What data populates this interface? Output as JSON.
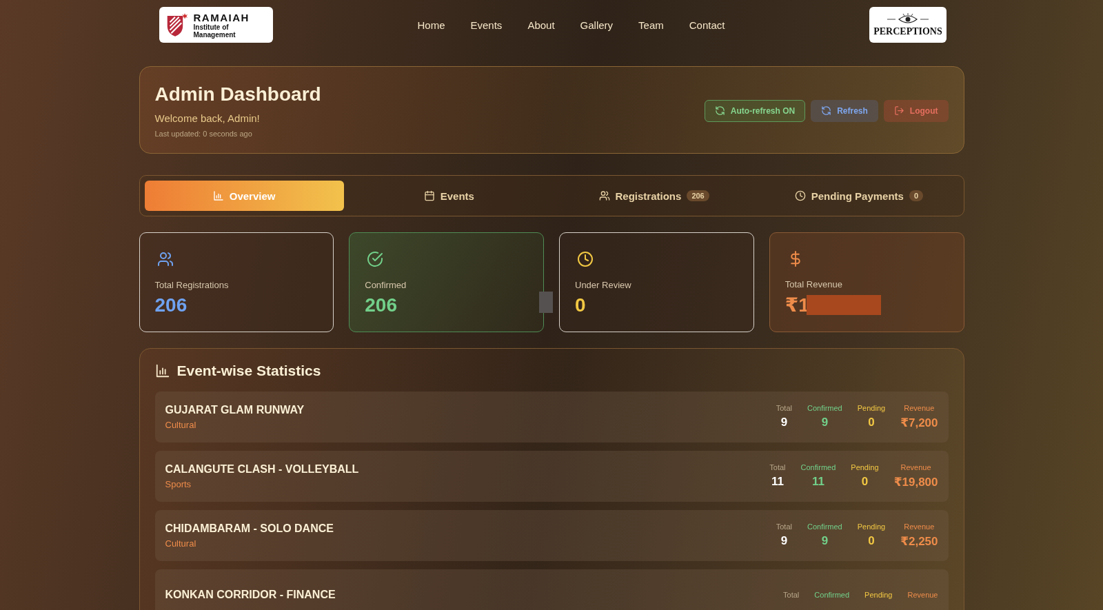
{
  "header": {
    "logo": {
      "title": "RAMAIAH",
      "subtitle": "Institute of Management"
    },
    "nav": [
      "Home",
      "Events",
      "About",
      "Gallery",
      "Team",
      "Contact"
    ],
    "brand_logo": {
      "text": "PERCEPTIONS"
    }
  },
  "dashboard": {
    "title": "Admin Dashboard",
    "welcome": "Welcome back, Admin!",
    "last_updated": "Last updated: 0 seconds ago",
    "buttons": [
      {
        "label": "Auto-refresh ON",
        "kind": "auto"
      },
      {
        "label": "Refresh",
        "kind": "refresh"
      },
      {
        "label": "Logout",
        "kind": "logout"
      }
    ]
  },
  "tabs": [
    {
      "label": "Overview",
      "kind": "chart",
      "selected": true
    },
    {
      "label": "Events",
      "kind": "calendar",
      "selected": false
    },
    {
      "label": "Registrations",
      "kind": "users",
      "badge": "206",
      "selected": false
    },
    {
      "label": "Pending Payments",
      "kind": "clock",
      "badge": "0",
      "selected": false
    }
  ],
  "stat_cards": [
    {
      "kind": "users",
      "label": "Total Registrations",
      "value": "206",
      "color": "#6fa2f0"
    },
    {
      "kind": "confirmed",
      "label": "Confirmed",
      "value": "206",
      "color": "#72d08a"
    },
    {
      "kind": "review",
      "label": "Under Review",
      "value": "0",
      "color": "#f2c843"
    },
    {
      "kind": "revenue",
      "label": "Total Revenue",
      "value": "₹1",
      "color": "#ee8c4a",
      "redacted": true
    }
  ],
  "event_stats": {
    "title": "Event-wise Statistics",
    "rows": [
      {
        "name": "GUJARAT GLAM RUNWAY",
        "category": "Cultural",
        "stats": [
          {
            "kind": "total",
            "label": "Total",
            "value": "9"
          },
          {
            "kind": "confirmed",
            "label": "Confirmed",
            "value": "9"
          },
          {
            "kind": "pending",
            "label": "Pending",
            "value": "0"
          },
          {
            "kind": "revenue",
            "label": "Revenue",
            "value": "₹7,200"
          }
        ]
      },
      {
        "name": "CALANGUTE CLASH - VOLLEYBALL",
        "category": "Sports",
        "stats": [
          {
            "kind": "total",
            "label": "Total",
            "value": "11"
          },
          {
            "kind": "confirmed",
            "label": "Confirmed",
            "value": "11"
          },
          {
            "kind": "pending",
            "label": "Pending",
            "value": "0"
          },
          {
            "kind": "revenue",
            "label": "Revenue",
            "value": "₹19,800"
          }
        ]
      },
      {
        "name": "CHIDAMBARAM - SOLO DANCE",
        "category": "Cultural",
        "stats": [
          {
            "kind": "total",
            "label": "Total",
            "value": "9"
          },
          {
            "kind": "confirmed",
            "label": "Confirmed",
            "value": "9"
          },
          {
            "kind": "pending",
            "label": "Pending",
            "value": "0"
          },
          {
            "kind": "revenue",
            "label": "Revenue",
            "value": "₹2,250"
          }
        ]
      },
      {
        "name": "KONKAN CORRIDOR - FINANCE",
        "stats": [
          {
            "kind": "total",
            "label": "Total"
          },
          {
            "kind": "confirmed",
            "label": "Confirmed"
          },
          {
            "kind": "pending",
            "label": "Pending"
          },
          {
            "kind": "revenue",
            "label": "Revenue"
          }
        ]
      }
    ]
  }
}
